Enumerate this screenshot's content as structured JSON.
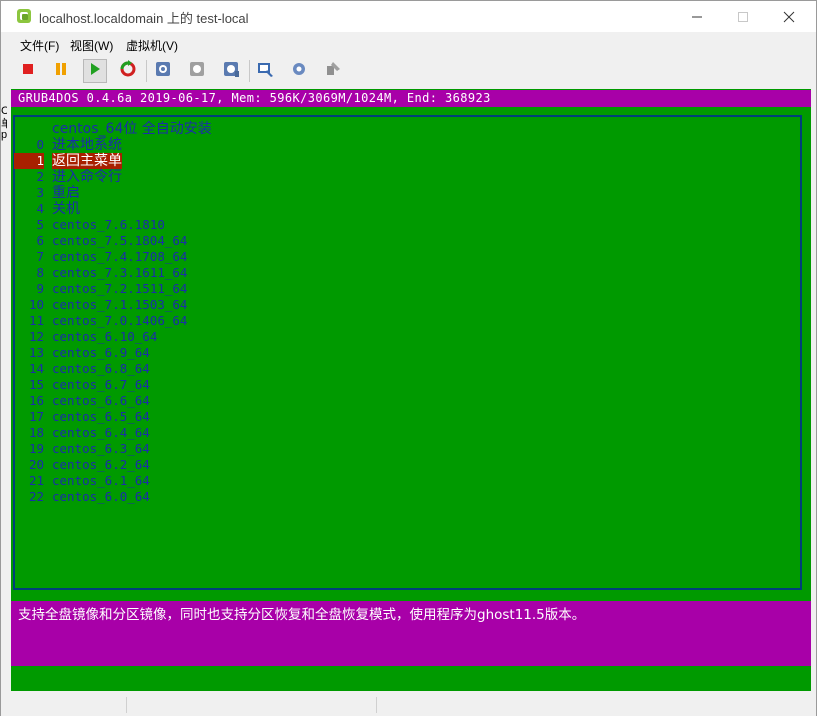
{
  "window": {
    "title": "localhost.localdomain 上的 test-local"
  },
  "menu": {
    "items": [
      "文件(F)",
      "视图(W)",
      "虚拟机(V)"
    ]
  },
  "toolbar": {
    "buttons": [
      "stop-icon",
      "pause-icon",
      "play-icon",
      "reset-icon",
      "snapshot-icon",
      "revert-snapshot-icon",
      "manage-snapshot-icon",
      "console-settings-icon",
      "edit-settings-icon",
      "install-tools-icon"
    ]
  },
  "console": {
    "header": "GRUB4DOS 0.4.6a 2019-06-17, Mem: 596K/3069M/1024M, End: 368923",
    "title_entry": "centos_64位 全自动安装",
    "entries": [
      {
        "num": "0",
        "label": "进本地系统"
      },
      {
        "num": "1",
        "label": "返回主菜单"
      },
      {
        "num": "2",
        "label": "进入命令行"
      },
      {
        "num": "3",
        "label": "重启"
      },
      {
        "num": "4",
        "label": "关机"
      },
      {
        "num": "5",
        "label": "centos_7.6.1810"
      },
      {
        "num": "6",
        "label": "centos_7.5.1804_64"
      },
      {
        "num": "7",
        "label": "centos_7.4.1708_64"
      },
      {
        "num": "8",
        "label": "centos_7.3.1611_64"
      },
      {
        "num": "9",
        "label": "centos_7.2.1511_64"
      },
      {
        "num": "10",
        "label": "centos_7.1.1503_64"
      },
      {
        "num": "11",
        "label": "centos_7.0.1406_64"
      },
      {
        "num": "12",
        "label": "centos_6.10_64"
      },
      {
        "num": "13",
        "label": "centos_6.9_64"
      },
      {
        "num": "14",
        "label": "centos_6.8_64"
      },
      {
        "num": "15",
        "label": "centos_6.7_64"
      },
      {
        "num": "16",
        "label": "centos_6.6_64"
      },
      {
        "num": "17",
        "label": "centos_6.5_64"
      },
      {
        "num": "18",
        "label": "centos_6.4_64"
      },
      {
        "num": "19",
        "label": "centos_6.3_64"
      },
      {
        "num": "20",
        "label": "centos_6.2_64"
      },
      {
        "num": "21",
        "label": "centos_6.1_64"
      },
      {
        "num": "22",
        "label": "centos_6.0_64"
      }
    ],
    "selected_index": 1,
    "description": "支持全盘镜像和分区镜像，同时也支持分区恢复和全盘恢复模式，使用程序为ghost11.5版本。"
  },
  "colors": {
    "screen_green": "#009a00",
    "bar_magenta": "#a800a8",
    "entry_blue": "#1a2ea8",
    "selection_red": "#a82000"
  }
}
